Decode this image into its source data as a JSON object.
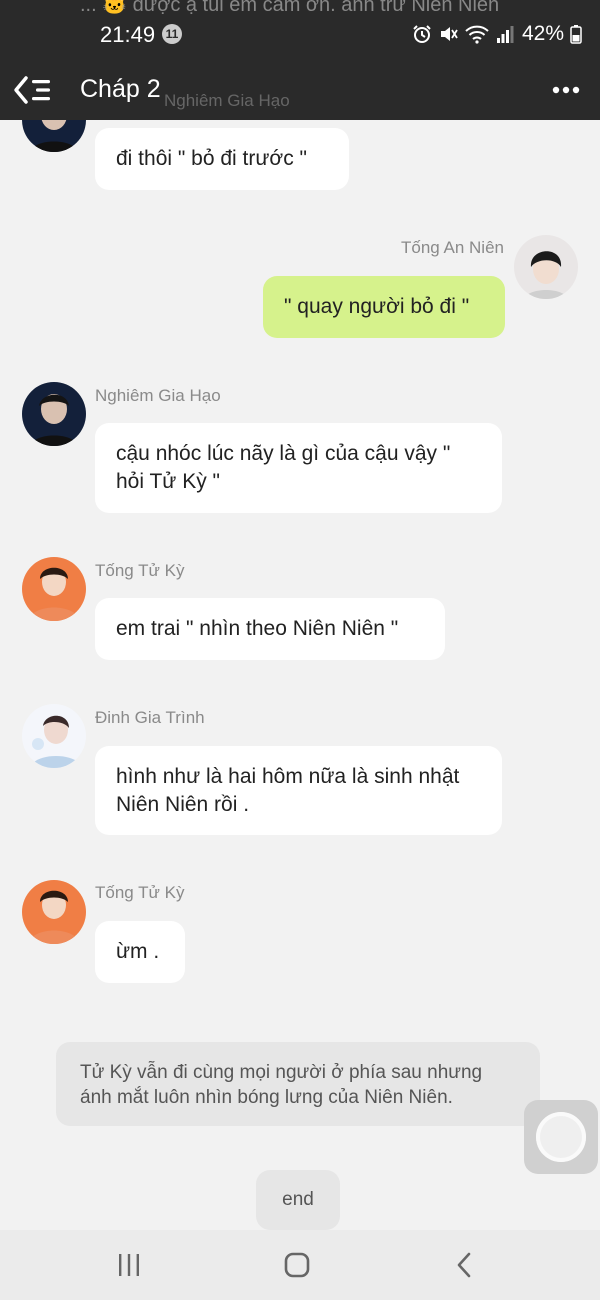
{
  "status_bar": {
    "time": "21:49",
    "notification_count": "11",
    "battery": "42%",
    "overlap_text": "... 🐱 được ạ tui em cảm ơn. anh trừ Niên Niên"
  },
  "header": {
    "title": "Cháp 2",
    "overlap_name": "Nghiêm Gia Hạo"
  },
  "messages": [
    {
      "sender": "",
      "text": "đi thôi \" bỏ đi trước \"",
      "side": "left"
    },
    {
      "sender": "Tống An Niên",
      "text": "\" quay người bỏ đi \"",
      "side": "right"
    },
    {
      "sender": "Nghiêm Gia Hạo",
      "text": "cậu nhóc lúc nãy là gì của cậu vậy \" hỏi Tử Kỳ \"",
      "side": "left"
    },
    {
      "sender": "Tống Tử Kỳ",
      "text": "em trai \" nhìn theo Niên Niên \"",
      "side": "left"
    },
    {
      "sender": "Đinh Gia Trình",
      "text": "hình như là hai hôm nữa là sinh nhật Niên Niên rồi .",
      "side": "left"
    },
    {
      "sender": "Tống Tử Kỳ",
      "text": "ừm .",
      "side": "left"
    }
  ],
  "narration": "Tử Kỳ vẫn đi cùng mọi người ở phía sau nhưng ánh mắt luôn nhìn bóng lưng của Niên Niên.",
  "end_label": "end",
  "colors": {
    "my_bubble": "#d6f28c",
    "header_bg": "#2a2a2a",
    "chat_bg": "#f2f2f2"
  }
}
